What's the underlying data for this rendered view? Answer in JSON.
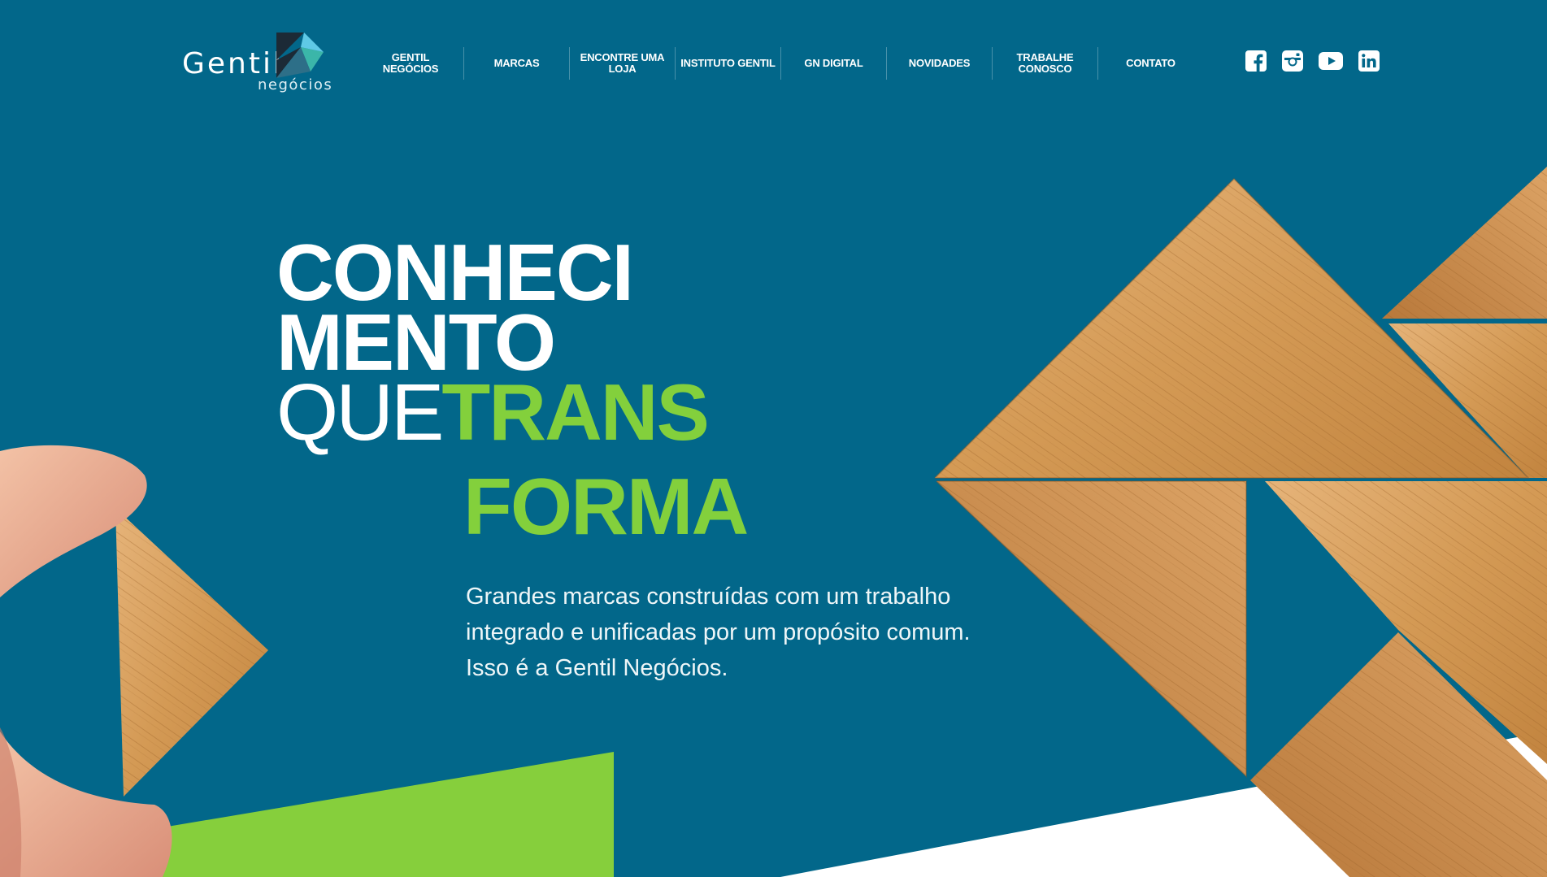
{
  "brand": {
    "name": "Gentil",
    "subtitle": "negócios",
    "colors": {
      "primary": "#02678a",
      "accent": "#83d03c",
      "wood": "#d9a463"
    }
  },
  "nav": {
    "items": [
      {
        "label": "GENTIL NEGÓCIOS"
      },
      {
        "label": "MARCAS"
      },
      {
        "label": "ENCONTRE UMA LOJA"
      },
      {
        "label": "INSTITUTO GENTIL"
      },
      {
        "label": "GN DIGITAL"
      },
      {
        "label": "NOVIDADES"
      },
      {
        "label": "TRABALHE CONOSCO"
      },
      {
        "label": "CONTATO"
      }
    ]
  },
  "social": {
    "icons": [
      "facebook-icon",
      "instagram-icon",
      "youtube-icon",
      "linkedin-icon"
    ]
  },
  "hero": {
    "line1": "CONHECI",
    "line2": "MENTO",
    "line3_plain": "QUE",
    "line3_accent": "TRANS",
    "line4_accent": "FORMA",
    "description": "Grandes marcas construídas com um trabalho integrado e unificadas por um propósito comum. Isso é a Gentil Negócios."
  }
}
